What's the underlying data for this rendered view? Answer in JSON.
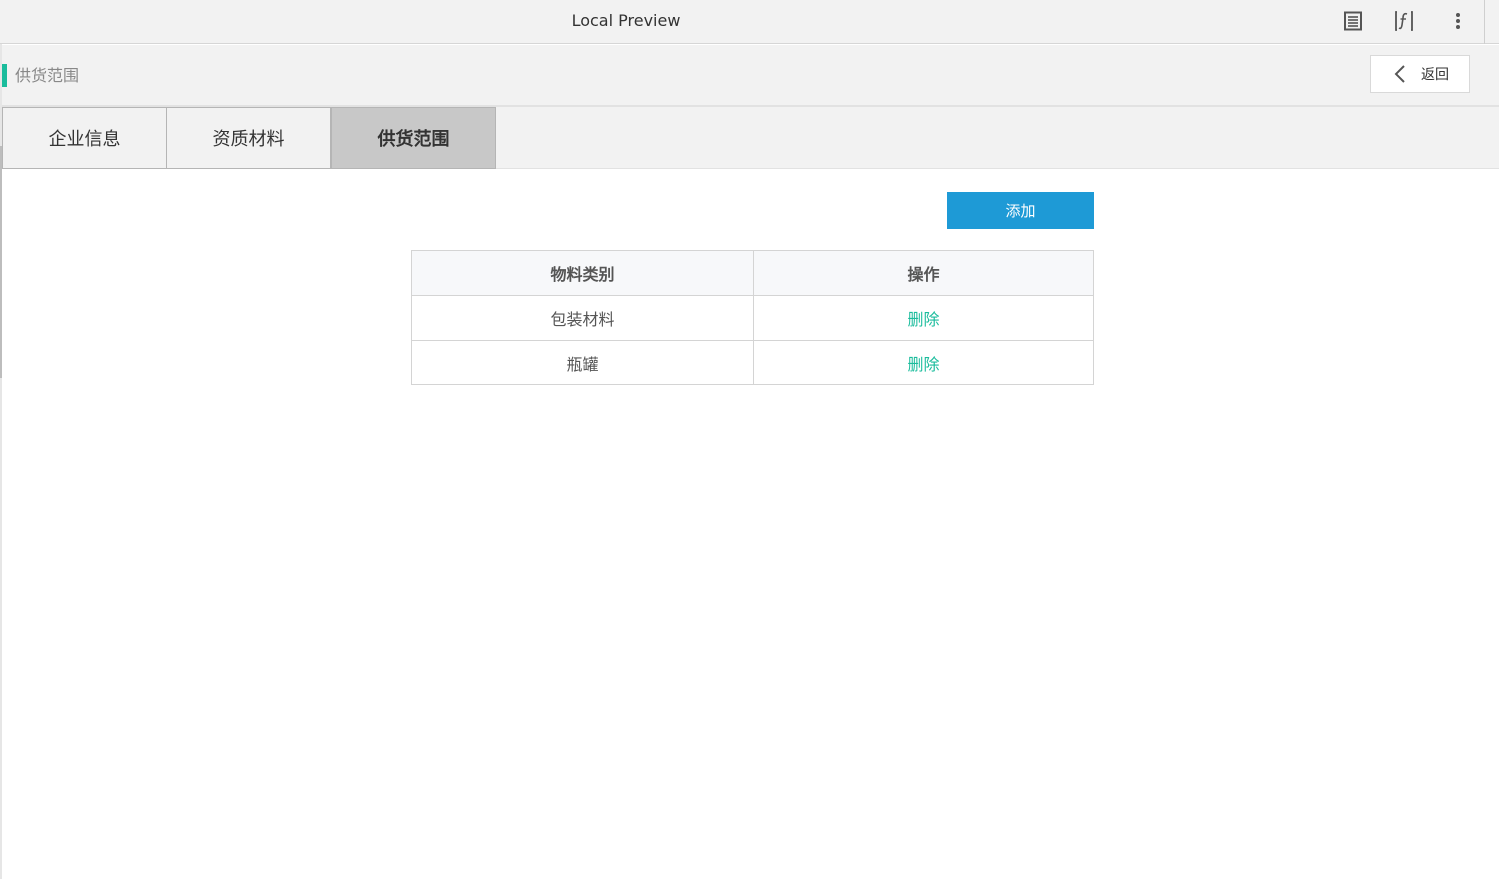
{
  "window": {
    "title": "Local Preview",
    "icons": [
      "document-list-icon",
      "variable-fx-icon",
      "more-vertical-icon"
    ]
  },
  "header": {
    "title": "供货范围",
    "back_label": "返回",
    "accent_color": "#1abc9c"
  },
  "tabs": [
    {
      "label": "企业信息",
      "active": false
    },
    {
      "label": "资质材料",
      "active": false
    },
    {
      "label": "供货范围",
      "active": true
    }
  ],
  "toolbar": {
    "add_label": "添加",
    "add_color": "#1e9ad6"
  },
  "table": {
    "columns": [
      "物料类别",
      "操作"
    ],
    "rows": [
      {
        "category": "包装材料",
        "action": "删除"
      },
      {
        "category": "瓶罐",
        "action": "删除"
      }
    ],
    "action_color": "#1abc9c"
  }
}
